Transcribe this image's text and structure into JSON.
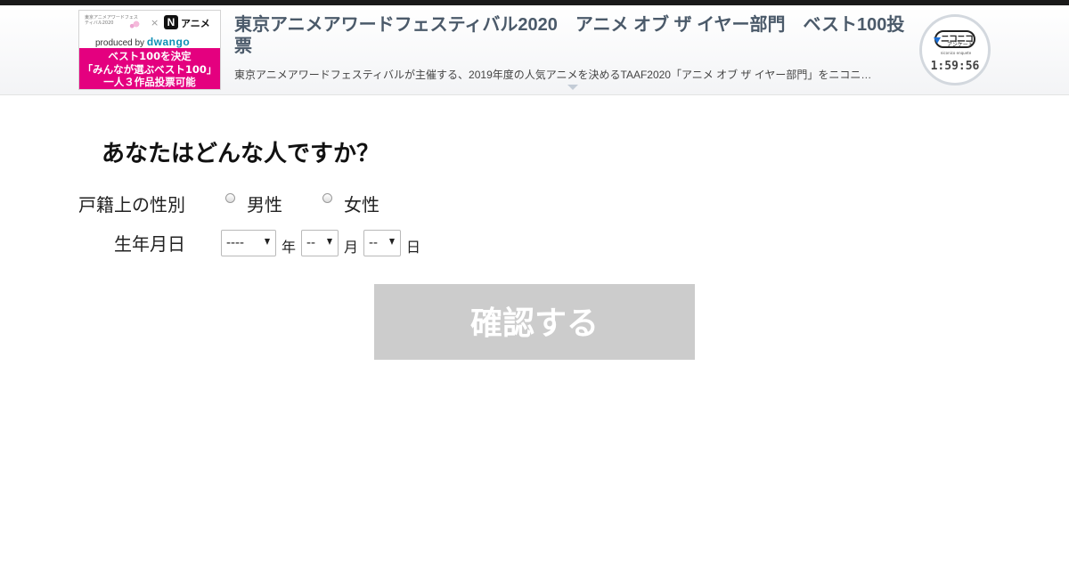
{
  "header": {
    "banner": {
      "logo_text": "東京アニメアワードフェスティバル2020",
      "times_symbol": "×",
      "partner_logo_letter": "N",
      "partner_logo_text": "アニメ",
      "produced_by_label": "produced by",
      "produced_by_brand": "dwango",
      "lines": [
        "ベスト100を決定",
        "「みんなが選ぶベスト100」",
        "一人３作品投票可能"
      ],
      "brand_color": "#e4007f"
    },
    "title": "東京アニメアワードフェスティバル2020　アニメ オブ ザ イヤー部門　ベスト100投票",
    "description": "東京アニメアワードフェスティバルが主催する、2019年度の人気アニメを決めるTAAF2020「アニメ オブ ザ イヤー部門」をニコニ…",
    "timer": {
      "logo_text": "ニコニコ",
      "logo_subtext": "アンケート",
      "logo_small": "niconico enquete",
      "remaining": "1:59:56"
    }
  },
  "form": {
    "question": "あなたはどんな人ですか？",
    "gender": {
      "label": "戸籍上の性別",
      "options": [
        "男性",
        "女性"
      ]
    },
    "birthdate": {
      "label": "生年月日",
      "year": {
        "value": "----",
        "unit": "年"
      },
      "month": {
        "value": "--",
        "unit": "月"
      },
      "day": {
        "value": "--",
        "unit": "日"
      }
    },
    "confirm_label": "確認する"
  },
  "colors": {
    "header_title": "#4b5a6a",
    "button_disabled": "#cccccc"
  },
  "icons": [
    "niconico-enquete-logo-icon",
    "chevron-down-icon",
    "radio-icon",
    "select-arrow-icon"
  ]
}
